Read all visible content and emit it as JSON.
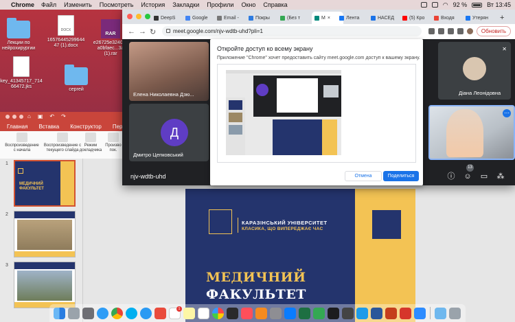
{
  "menubar": {
    "app": "Chrome",
    "items": [
      "Файл",
      "Изменить",
      "Посмотреть",
      "История",
      "Закладки",
      "Профили",
      "Окно",
      "Справка"
    ],
    "battery": "92 %",
    "clock": "Вт 13:45"
  },
  "desktop": {
    "icons": [
      {
        "label": "Лекции по нейрохирургии",
        "type": "folder"
      },
      {
        "label": "16576445299644 47 (1).docx",
        "type": "doc",
        "badge": "DOCX"
      },
      {
        "label": "e26725e3240ec a0bfaec...3a (1).rar",
        "type": "rar",
        "badge": "RAR"
      },
      {
        "label": "key_41345717_714 66472.jks",
        "type": "doc",
        "badge": ""
      },
      {
        "label": "сергей",
        "type": "folder"
      }
    ]
  },
  "powerpoint": {
    "ribbon_tabs": [
      "Главная",
      "Вставка",
      "Конструктор",
      "Переходы"
    ],
    "ribbon_buttons": [
      "Воспроизведение с начала",
      "Воспроизведение с текущего слайда",
      "Режим докладчика",
      "Произво пок."
    ],
    "slides": [
      {
        "number": "1",
        "title": "МЕДИЧНИЙ ФАКУЛЬТЕТ"
      },
      {
        "number": "2",
        "title": ""
      },
      {
        "number": "3",
        "title": ""
      }
    ],
    "main_slide": {
      "university": "КАРАЗІНСЬКИЙ УНІВЕРСИТЕТ",
      "motto": "КЛАСИКА, ЩО ВИПЕРЕДЖАЄ ЧАС",
      "title_line1": "МЕДИЧНИЙ",
      "title_line2": "ФАКУЛЬТЕТ"
    }
  },
  "chrome": {
    "tabs": [
      {
        "label": "DeepS",
        "color": "#333333"
      },
      {
        "label": "Google",
        "color": "#4285f4"
      },
      {
        "label": "Email -",
        "color": "#777777"
      },
      {
        "label": "Покры",
        "color": "#2d7be0"
      },
      {
        "label": "(Без т",
        "color": "#34a853"
      },
      {
        "label": "M",
        "color": "#00897b",
        "active": true
      },
      {
        "label": "Лента",
        "color": "#1877f2"
      },
      {
        "label": "НАСЕД",
        "color": "#1a73e8"
      },
      {
        "label": "(5) Кро",
        "color": "#ff0000"
      },
      {
        "label": "Входя",
        "color": "#ea4335"
      },
      {
        "label": "Утерян",
        "color": "#1877f2"
      }
    ],
    "url": "meet.google.com/njv-wdtb-uhd?pli=1",
    "update_button": "Обновить"
  },
  "meet": {
    "participants": [
      {
        "name": "Елена Николаевна Дзю..."
      },
      {
        "name": "Діана Леонідовна"
      },
      {
        "name": "Дмитро Цепковський",
        "initial": "Д"
      }
    ],
    "meeting_code": "njv-wdtb-uhd",
    "people_count": "13",
    "dialog": {
      "title": "Откройте доступ ко всему экрану",
      "description": "Приложение \"Chrome\" хочет предоставить сайту meet.google.com доступ к вашему экрану.",
      "cancel": "Отмена",
      "share": "Поделиться"
    }
  },
  "colors": {
    "powerpoint_accent": "#c9453b",
    "meet_bg": "#202124",
    "slide_blue": "#24346d",
    "slide_gold": "#f3c354",
    "google_blue": "#1a73e8"
  }
}
